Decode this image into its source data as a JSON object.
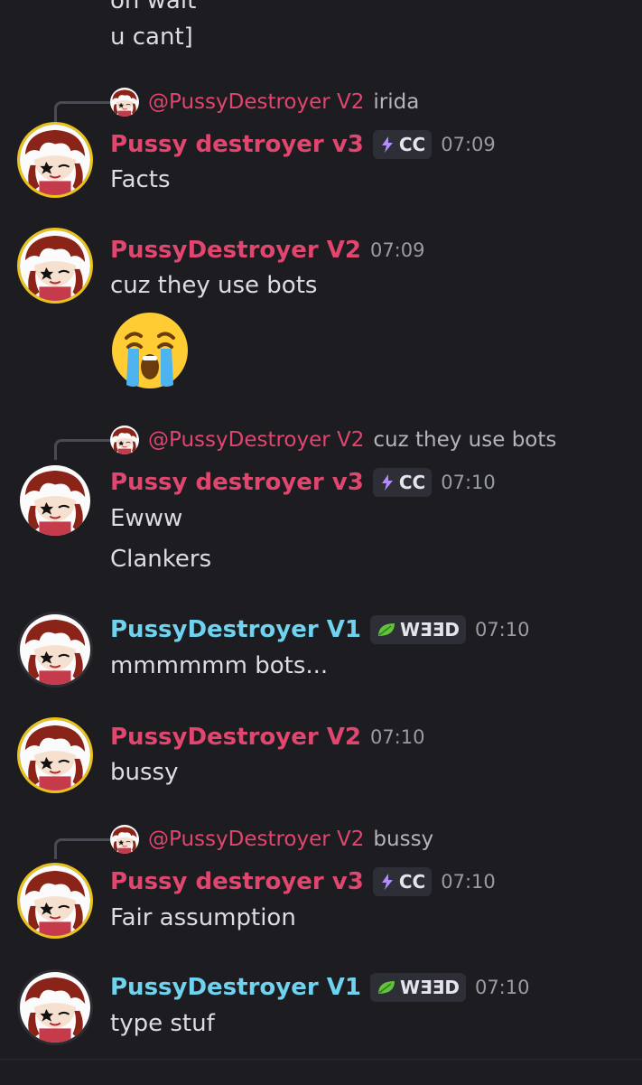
{
  "top_fragment": [
    "oh wait",
    "u cant]"
  ],
  "messages": [
    {
      "reply": {
        "to": "@PussyDestroyer V2",
        "text": "irida"
      },
      "author": "Pussy destroyer v3",
      "author_color": "#e0466e",
      "tag": {
        "icon": "lightning-icon",
        "text": "CC"
      },
      "time": "07:09",
      "lines": [
        "Facts"
      ]
    },
    {
      "author": "PussyDestroyer V2",
      "author_color": "#e0466e",
      "time": "07:09",
      "lines": [
        "cuz they use bots"
      ],
      "emoji": "loudly-crying-face"
    },
    {
      "reply": {
        "to": "@PussyDestroyer V2",
        "text": "cuz they use bots"
      },
      "author": "Pussy destroyer v3",
      "author_color": "#e0466e",
      "tag": {
        "icon": "lightning-icon",
        "text": "CC"
      },
      "time": "07:10",
      "lines": [
        "Ewww",
        "Clankers"
      ]
    },
    {
      "author": "PussyDestroyer V1",
      "author_color": "#6fd3ef",
      "tag": {
        "icon": "leaf-icon",
        "text": "WƎƎD"
      },
      "time": "07:10",
      "lines": [
        "mmmmmm bots..."
      ]
    },
    {
      "author": "PussyDestroyer V2",
      "author_color": "#e0466e",
      "time": "07:10",
      "lines": [
        "bussy"
      ]
    },
    {
      "reply": {
        "to": "@PussyDestroyer V2",
        "text": "bussy"
      },
      "author": "Pussy destroyer v3",
      "author_color": "#e0466e",
      "tag": {
        "icon": "lightning-icon",
        "text": "CC"
      },
      "time": "07:10",
      "lines": [
        "Fair assumption"
      ]
    },
    {
      "author": "PussyDestroyer V1",
      "author_color": "#6fd3ef",
      "tag": {
        "icon": "leaf-icon",
        "text": "WƎƎD"
      },
      "time": "07:10",
      "lines": [
        "type stuf"
      ]
    }
  ]
}
